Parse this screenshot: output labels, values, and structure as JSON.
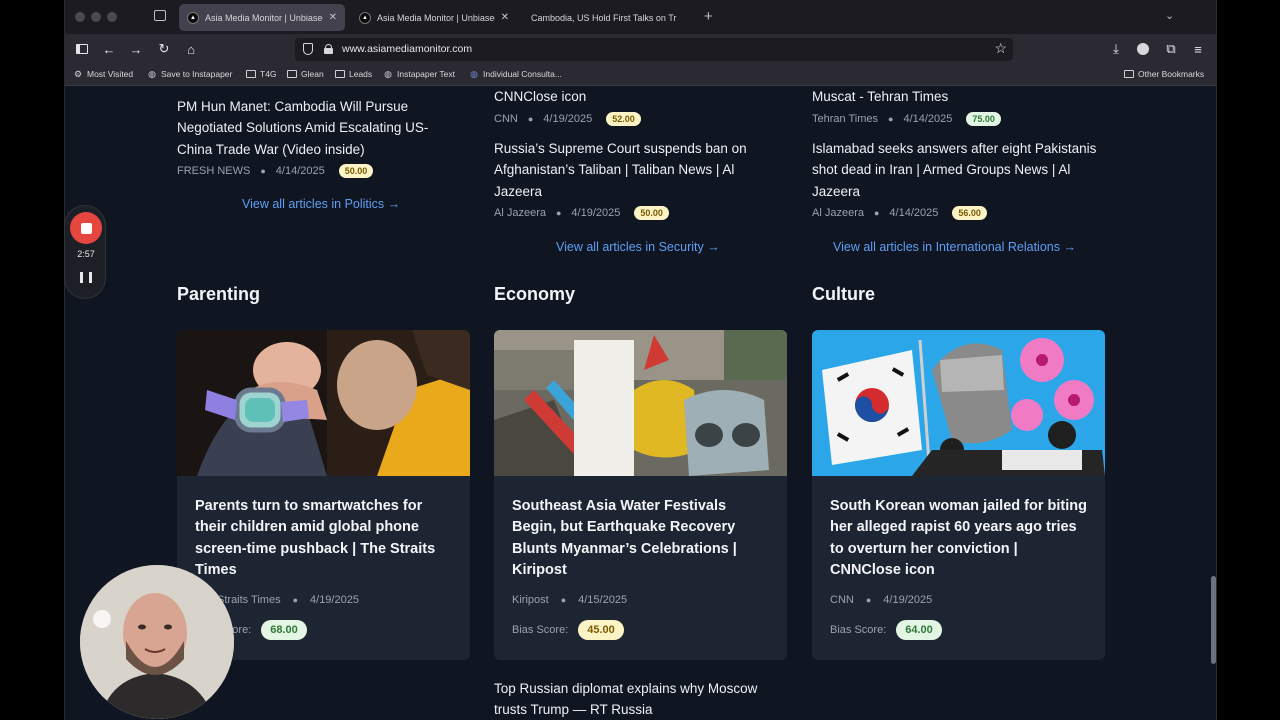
{
  "browser": {
    "tabs": [
      {
        "label": "Asia Media Monitor | Unbiased A",
        "active": true
      },
      {
        "label": "Asia Media Monitor | Unbiased A",
        "active": false
      },
      {
        "label": "Cambodia, US Hold First Talks on Tr",
        "active": false
      }
    ],
    "new_tab_symbol": "+",
    "url": "www.asiamediamonitor.com",
    "bookmarks": [
      {
        "label": "Most Visited",
        "icon": "gear-icon"
      },
      {
        "label": "Save to Instapaper",
        "icon": "globe-icon"
      },
      {
        "label": "T4G",
        "icon": "folder-icon"
      },
      {
        "label": "Glean",
        "icon": "folder-icon"
      },
      {
        "label": "Leads",
        "icon": "folder-icon"
      },
      {
        "label": "Instapaper Text",
        "icon": "globe-icon"
      },
      {
        "label": "Individual Consulta...",
        "icon": "globe-icon"
      }
    ],
    "other_bookmarks": "Other Bookmarks"
  },
  "recorder": {
    "time": "2:57"
  },
  "page": {
    "top_columns": [
      {
        "articles": [
          {
            "title": "PM Hun Manet: Cambodia Will Pursue Negotiated Solutions Amid Escalating US-China Trade War (Video inside)",
            "source": "FRESH NEWS",
            "date": "4/14/2025",
            "score": "50.00",
            "badge_color": "#fdf4c6"
          }
        ],
        "view_all": "View all articles in Politics →"
      },
      {
        "articles": [
          {
            "title": "CNNClose icon",
            "source": "CNN",
            "date": "4/19/2025",
            "score": "52.00",
            "badge_color": "#fdf4c6"
          },
          {
            "title": "Russia’s Supreme Court suspends ban on Afghanistan’s Taliban | Taliban News | Al Jazeera",
            "source": "Al Jazeera",
            "date": "4/19/2025",
            "score": "50.00",
            "badge_color": "#fdf4c6"
          }
        ],
        "view_all": "View all articles in Security →"
      },
      {
        "articles": [
          {
            "title": "Muscat - Tehran Times",
            "source": "Tehran Times",
            "date": "4/14/2025",
            "score": "75.00",
            "badge_color": "#e3f6e4"
          },
          {
            "title": "Islamabad seeks answers after eight Pakistanis shot dead in Iran | Armed Groups News | Al Jazeera",
            "source": "Al Jazeera",
            "date": "4/14/2025",
            "score": "56.00",
            "badge_color": "#fdf4c6"
          }
        ],
        "view_all": "View all articles in International Relations →"
      }
    ],
    "sections": [
      {
        "title": "Parenting",
        "card": {
          "title": "Parents turn to smartwatches for their children amid global phone screen-time pushback | The Straits Times",
          "source": "The Straits Times",
          "date": "4/19/2025",
          "bias_label": "Bias Score:",
          "score": "68.00",
          "badge_color": "#e3f6e4",
          "image": "child-smartwatch-photo"
        }
      },
      {
        "title": "Economy",
        "card": {
          "title": "Southeast Asia Water Festivals Begin, but Earthquake Recovery Blunts Myanmar’s Celebrations | Kiripost",
          "source": "Kiripost",
          "date": "4/15/2025",
          "bias_label": "Bias Score:",
          "score": "45.00",
          "badge_color": "#fdf4c6",
          "image": "festival-masks-photo"
        }
      },
      {
        "title": "Culture",
        "card": {
          "title": "South Korean woman jailed for biting her alleged rapist 60 years ago tries to overturn her conviction | CNNClose icon",
          "source": "CNN",
          "date": "4/19/2025",
          "bias_label": "Bias Score:",
          "score": "64.00",
          "badge_color": "#e3f6e4",
          "image": "korean-flag-protest-illustration"
        }
      }
    ],
    "below_article": {
      "title": "Top Russian diplomat explains why Moscow trusts Trump — RT Russia"
    }
  }
}
